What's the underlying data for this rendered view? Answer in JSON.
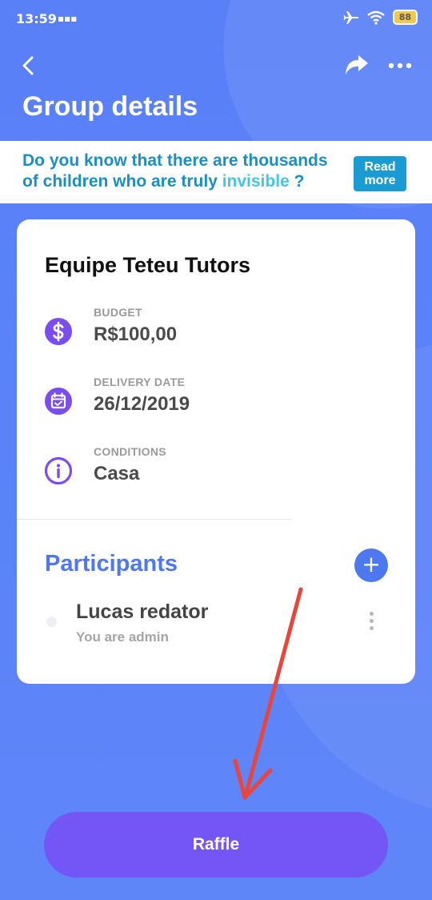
{
  "status_bar": {
    "time": "13:59",
    "battery": "88"
  },
  "header": {
    "title": "Group details"
  },
  "banner": {
    "line1": "Do you know that there are thousands",
    "line2_start": "of children who are truly ",
    "line2_highlight": "invisible",
    "line2_end": " ?",
    "button_line1": "Read",
    "button_line2": "more"
  },
  "group": {
    "name": "Equipe Teteu Tutors",
    "budget_label": "BUDGET",
    "budget_value": "R$100,00",
    "delivery_label": "DELIVERY DATE",
    "delivery_value": "26/12/2019",
    "conditions_label": "CONDITIONS",
    "conditions_value": "Casa"
  },
  "participants": {
    "title": "Participants",
    "add_symbol": "+",
    "items": [
      {
        "name": "Lucas redator",
        "role": "You are admin"
      }
    ]
  },
  "actions": {
    "raffle_label": "Raffle"
  },
  "colors": {
    "background": "#5a80f8",
    "accent_blue": "#4d78ef",
    "purple": "#7455f5",
    "icon_purple": "#7b4df0",
    "arrow_red": "#e8453c"
  }
}
